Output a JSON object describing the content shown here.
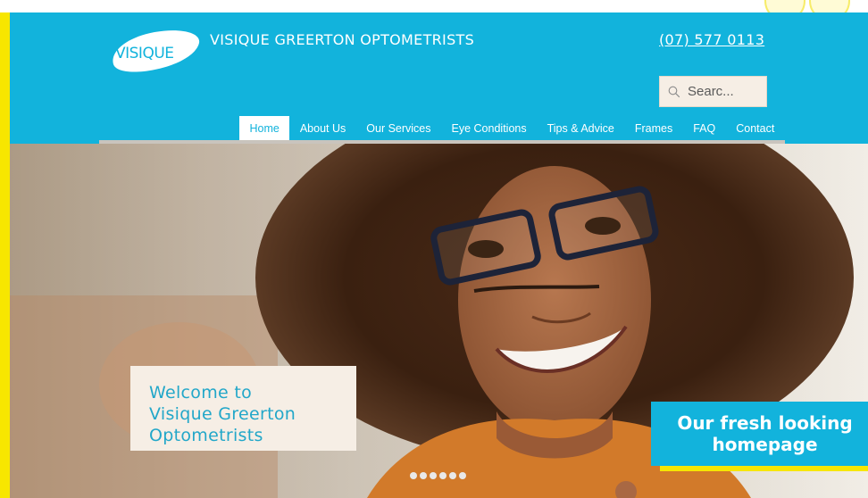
{
  "brand": {
    "logo_text": "VISIQUE",
    "site_title": "VISIQUE GREERTON OPTOMETRISTS",
    "phone": "(07) 577 0113"
  },
  "search": {
    "value": "Searc..."
  },
  "nav": {
    "items": [
      {
        "label": "Home",
        "active": true
      },
      {
        "label": "About Us"
      },
      {
        "label": "Our Services"
      },
      {
        "label": "Eye Conditions"
      },
      {
        "label": "Tips & Advice"
      },
      {
        "label": "Frames"
      },
      {
        "label": "FAQ"
      },
      {
        "label": "Contact"
      }
    ]
  },
  "hero": {
    "welcome_lines": [
      "Welcome to",
      "Visique Greerton",
      "Optometrists"
    ],
    "slide_count": 6
  },
  "promo": {
    "lines": [
      "Our fresh looking",
      "homepage"
    ]
  },
  "colors": {
    "brand_blue": "#12b3dc",
    "accent_yellow": "#f7e600",
    "cream": "#f6eee5"
  }
}
